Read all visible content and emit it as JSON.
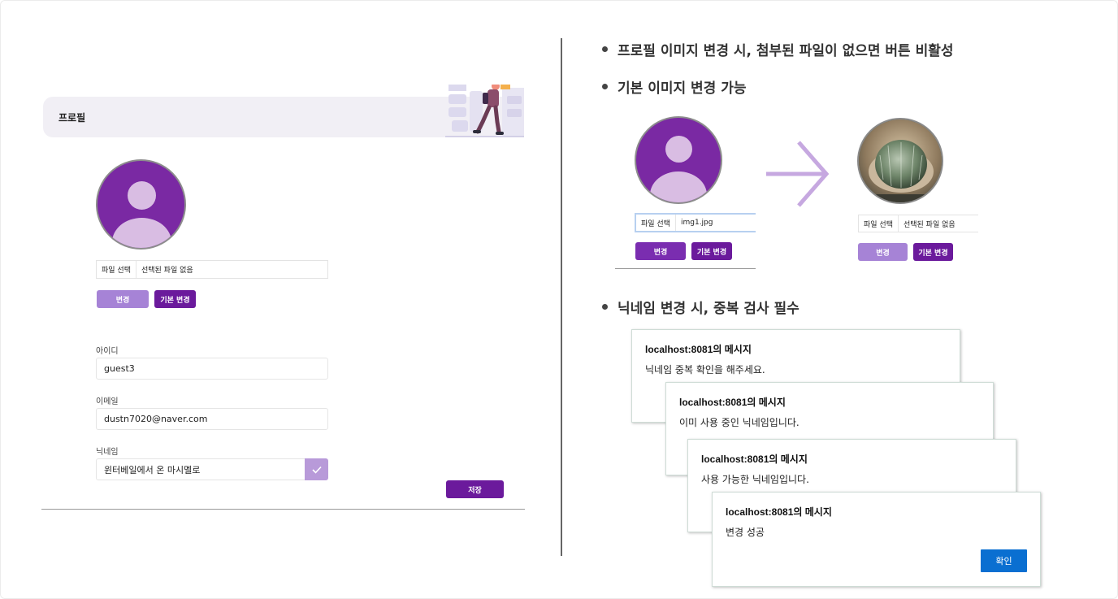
{
  "profile": {
    "title": "프로필",
    "file_button": "파일 선택",
    "file_status": "선택된 파일 없음",
    "change_button": "변경",
    "default_button": "기본 변경",
    "id_label": "아이디",
    "id_value": "guest3",
    "email_label": "이메일",
    "email_value": "dustn7020@naver.com",
    "nickname_label": "닉네임",
    "nickname_value": "윈터베일에서 온 마시멜로",
    "save_button": "저장"
  },
  "bullets": [
    "프로필 이미지 변경 시, 첨부된 파일이 없으면 버튼 비활성",
    "기본 이미지 변경 가능",
    "닉네임 변경 시, 중복 검사 필수"
  ],
  "demo_before": {
    "file_button": "파일 선택",
    "file_status": "img1.jpg",
    "change_button": "변경",
    "default_button": "기본 변경"
  },
  "demo_after": {
    "file_button": "파일 선택",
    "file_status": "선택된 파일 없음",
    "change_button": "변경",
    "default_button": "기본 변경"
  },
  "dialogs": [
    {
      "title": "localhost:8081의 메시지",
      "message": "닉네임 중복 확인을 해주세요."
    },
    {
      "title": "localhost:8081의 메시지",
      "message": "이미 사용 중인 닉네임입니다."
    },
    {
      "title": "localhost:8081의 메시지",
      "message": "사용 가능한 닉네임입니다."
    },
    {
      "title": "localhost:8081의 메시지",
      "message": "변경 성공",
      "ok_button": "확인"
    }
  ],
  "colors": {
    "avatar": "#7a29a3",
    "button_light": "#a683d6",
    "button_dark": "#6b1a9c",
    "arrow": "#c6a8e0",
    "ok_button": "#0a6fd1"
  },
  "icons": [
    "user-avatar-icon",
    "check-icon",
    "arrow-right-icon",
    "illustration-walking-person"
  ]
}
